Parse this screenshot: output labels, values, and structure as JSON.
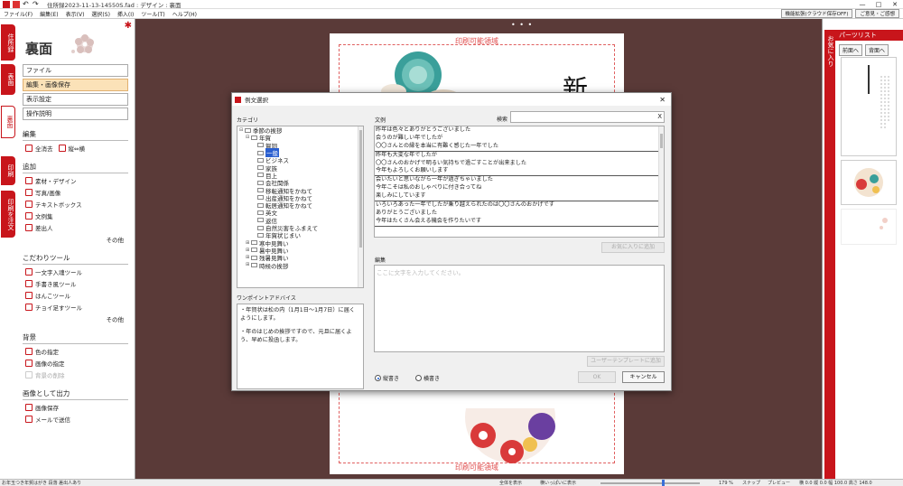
{
  "window": {
    "title": "住所録2023-11-13-14550S.fad : デザイン : 裏面",
    "min": "—",
    "max": "□",
    "close": "✕"
  },
  "menu": {
    "items": [
      "ファイル(F)",
      "編集(E)",
      "表示(V)",
      "選択(S)",
      "挿入(I)",
      "ツール(T)",
      "ヘルプ(H)"
    ],
    "right_buttons": [
      "機能拡張(クラウド保存OFF)",
      "ご意見・ご感想"
    ]
  },
  "left_tabs": [
    "住所録",
    "表面",
    "裏面",
    "印刷",
    "印刷を注文"
  ],
  "left_panel": {
    "title": "裏面",
    "buttons": [
      "ファイル",
      "編集・画像保存",
      "表示設定",
      "操作説明"
    ],
    "sections": {
      "edit": {
        "title": "編集",
        "items": [
          "全消去",
          "縦⇔横"
        ]
      },
      "add": {
        "title": "追加",
        "items": [
          "素材・デザイン",
          "写真/画像",
          "テキストボックス",
          "文例集",
          "差出人"
        ],
        "other": "その他"
      },
      "tools": {
        "title": "こだわりツール",
        "items": [
          "一文字入魂ツール",
          "手書き風ツール",
          "はんこツール",
          "チョイ足すツール"
        ],
        "other": "その他"
      },
      "background": {
        "title": "背景",
        "items": [
          "色の指定",
          "画像の指定",
          "背景の削除"
        ]
      },
      "output": {
        "title": "画像として出力",
        "items": [
          "画像保存",
          "メールで送信"
        ]
      }
    }
  },
  "canvas": {
    "print_area_label": "印刷可能領域",
    "handle": "• • •"
  },
  "right_panel": {
    "header": "パーツリスト",
    "vertical_tab": "お気に入り",
    "buttons": [
      "前面へ",
      "背面へ"
    ]
  },
  "dialog": {
    "title": "例文選択",
    "category_label": "カテゴリ",
    "categories": [
      {
        "indent": 0,
        "pm": "⊟",
        "label": "季節の挨拶"
      },
      {
        "indent": 1,
        "pm": "⊟",
        "label": "年賀"
      },
      {
        "indent": 2,
        "pm": "",
        "label": "賀詞"
      },
      {
        "indent": 2,
        "pm": "",
        "label": "一般",
        "selected": true
      },
      {
        "indent": 2,
        "pm": "",
        "label": "ビジネス"
      },
      {
        "indent": 2,
        "pm": "",
        "label": "家族"
      },
      {
        "indent": 2,
        "pm": "",
        "label": "目上"
      },
      {
        "indent": 2,
        "pm": "",
        "label": "会社関係"
      },
      {
        "indent": 2,
        "pm": "",
        "label": "移転通知をかねて"
      },
      {
        "indent": 2,
        "pm": "",
        "label": "出産通知をかねて"
      },
      {
        "indent": 2,
        "pm": "",
        "label": "転居通知をかねて"
      },
      {
        "indent": 2,
        "pm": "",
        "label": "英文"
      },
      {
        "indent": 2,
        "pm": "",
        "label": "返信"
      },
      {
        "indent": 2,
        "pm": "",
        "label": "自然災害をふまえて"
      },
      {
        "indent": 2,
        "pm": "",
        "label": "年賀状じまい"
      },
      {
        "indent": 1,
        "pm": "⊞",
        "label": "寒中見舞い"
      },
      {
        "indent": 1,
        "pm": "⊞",
        "label": "暑中見舞い"
      },
      {
        "indent": 1,
        "pm": "⊞",
        "label": "残暑見舞い"
      },
      {
        "indent": 1,
        "pm": "⊞",
        "label": "時候の挨拶"
      }
    ],
    "advice_label": "ワンポイントアドバイス",
    "advice_text": [
      "・年賀状は松の内（1月1日～1月7日）に届くようにします。",
      "・年のはじめの挨拶ですので、元旦に届くよう、早めに投函します。"
    ],
    "examples_label": "文例",
    "search_label": "検索",
    "search_value": "",
    "search_clear": "X",
    "examples": [
      [
        "昨年は色々とありがとうございました",
        "会うのが難しい年でしたが",
        "〇〇さんとの縁を本当に有難く感じた一年でした"
      ],
      [
        "昨年も大変な年でしたが",
        "〇〇さんのおかげで明るい気持ちで過ごすことが出来ました",
        "今年もよろしくお願いします"
      ],
      [
        "会いたいと思いながら一年が過ぎちゃいました",
        "今年こそは私のおしゃべりに付き合ってね",
        "楽しみにしています"
      ],
      [
        "いろいろあった一年でしたが乗り越えられたのは〇〇さんのおかげです",
        "ありがとうございました",
        "今年はたくさん会える機会を作りたいです"
      ]
    ],
    "fav_button": "お気に入りに追加",
    "edit_label": "編集",
    "edit_placeholder": "ここに文字を入力してください。",
    "template_button": "ユーザーテンプレートに追加",
    "radio_vertical": "縦書き",
    "radio_horizontal": "横書き",
    "ok": "OK",
    "cancel": "キャンセル"
  },
  "status": {
    "left": "お年玉つき年賀はがき 段落 差出人あり",
    "fit_all": "全体を表示",
    "fit_width": "横いっぱいに表示",
    "zoom": "179 %",
    "snap": "スナップ",
    "preview": "プレビュー",
    "coords": "横 0.0 縦 0.0  幅 100.0 高さ 148.0"
  }
}
